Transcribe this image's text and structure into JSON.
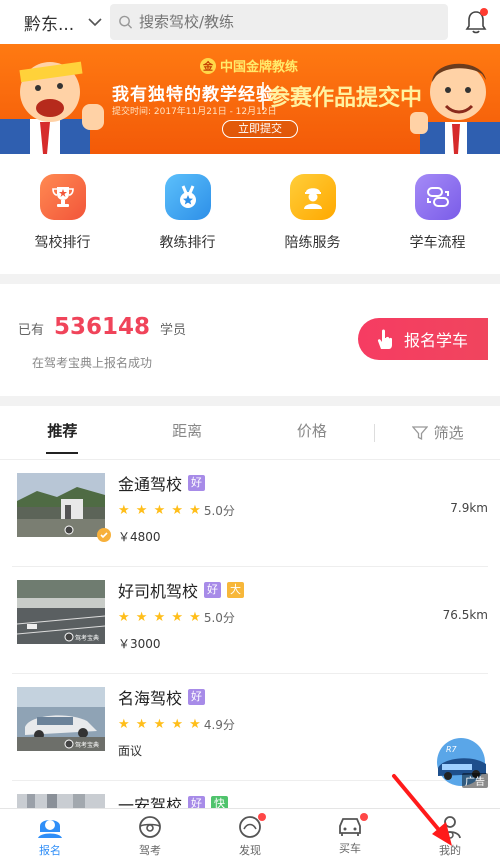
{
  "header": {
    "city": "黔东...",
    "search_placeholder": "搜索驾校/教练"
  },
  "banner": {
    "brand": "中国金牌教练",
    "title": "我有独特的教学经验",
    "subtitle": "提交时间: 2017年11月21日 - 12月12日",
    "right_text": "参赛作品提交中",
    "button": "立即提交"
  },
  "quick_menu": [
    {
      "label": "驾校排行",
      "icon": "trophy-icon",
      "color": "#ff6a3d"
    },
    {
      "label": "教练排行",
      "icon": "medal-icon",
      "color": "#3aa8f0"
    },
    {
      "label": "陪练服务",
      "icon": "driver-icon",
      "color": "#ffb400"
    },
    {
      "label": "学车流程",
      "icon": "flow-icon",
      "color": "#8b6cf0"
    }
  ],
  "enroll": {
    "prefix": "已有",
    "count": "536148",
    "suffix": "学员",
    "success_text": "在驾考宝典上报名成功",
    "button": "报名学车"
  },
  "filter_tabs": [
    "推荐",
    "距离",
    "价格",
    "筛选"
  ],
  "schools": [
    {
      "name": "金通驾校",
      "badges": [
        {
          "text": "好",
          "color": "#a78be8"
        }
      ],
      "rating": "5.0分",
      "price": "￥4800",
      "distance": "7.9km"
    },
    {
      "name": "好司机驾校",
      "badges": [
        {
          "text": "好",
          "color": "#a78be8"
        },
        {
          "text": "大",
          "color": "#f7b73a"
        }
      ],
      "rating": "5.0分",
      "price": "￥3000",
      "distance": "76.5km"
    },
    {
      "name": "名海驾校",
      "badges": [
        {
          "text": "好",
          "color": "#a78be8"
        }
      ],
      "rating": "4.9分",
      "price": "面议",
      "distance": ""
    },
    {
      "name": "一安驾校",
      "badges": [
        {
          "text": "好",
          "color": "#a78be8"
        },
        {
          "text": "快",
          "color": "#4fc36c"
        }
      ],
      "rating": "",
      "price": "",
      "distance": ""
    }
  ],
  "thumb_watermark": "驾考宝典",
  "ad": {
    "label": "广告"
  },
  "tabbar": [
    {
      "label": "报名",
      "icon": "enroll-icon",
      "active": true,
      "dot": false
    },
    {
      "label": "驾考",
      "icon": "steering-wheel-icon",
      "active": false,
      "dot": false
    },
    {
      "label": "发现",
      "icon": "discover-icon",
      "active": false,
      "dot": true
    },
    {
      "label": "买车",
      "icon": "car-icon",
      "active": false,
      "dot": true
    },
    {
      "label": "我的",
      "icon": "profile-icon",
      "active": false,
      "dot": false
    }
  ],
  "colors": {
    "accent": "#f0445a",
    "active_blue": "#2f8ef7",
    "banner_orange": "#f35a08"
  }
}
